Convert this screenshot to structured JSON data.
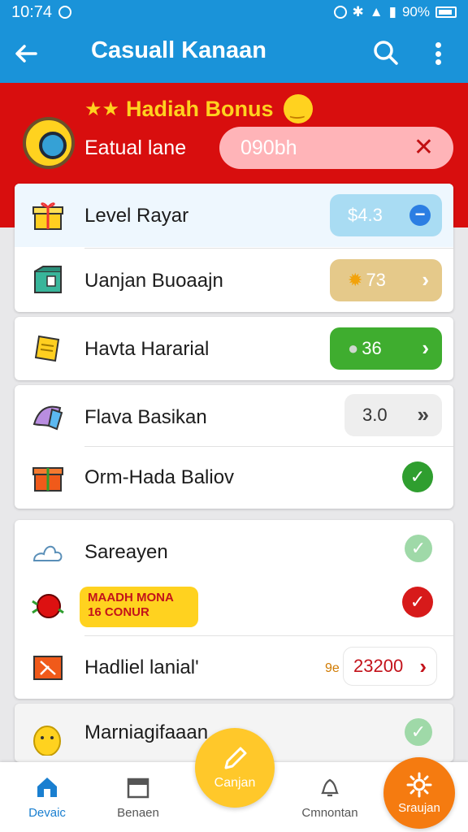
{
  "status": {
    "time": "10:74",
    "battery": "90%"
  },
  "appbar": {
    "title": "Casuall Kanaan"
  },
  "banner": {
    "title": "Hadiah Bonus",
    "subtitle": "Eatual lane",
    "code_value": "090bh"
  },
  "list": {
    "card1": [
      {
        "label": "Level Rayar",
        "value": "$4.3",
        "icon": "gift-box-icon",
        "action": "minus"
      },
      {
        "label": "Uanjan Buoaajn",
        "value": "73",
        "icon": "package-icon",
        "action": "chevron"
      }
    ],
    "card2": [
      {
        "label": "Havta Hararial",
        "value": "36",
        "icon": "ticket-icon",
        "action": "chevron"
      }
    ],
    "card3": [
      {
        "label": "Flava Basikan",
        "value": "3.0",
        "icon": "ribbon-icon",
        "action": "chevron"
      },
      {
        "label": "Orm-Hada Baliov",
        "icon": "present-icon",
        "action": "check"
      }
    ],
    "card4": [
      {
        "label": "Sareayen",
        "icon": "cloud-icon",
        "action": "check-faded"
      },
      {
        "tag": "MAADH MONA 16 CONUR",
        "icon": "apple-icon",
        "action": "check-red"
      },
      {
        "label": "Hadliel lanial'",
        "prefix": "9e",
        "value": "23200",
        "icon": "envelope-icon",
        "action": "chevron-red"
      }
    ],
    "card5": [
      {
        "label": "Marniagifaaan",
        "icon": "chick-icon",
        "action": "check-faded"
      }
    ]
  },
  "bottomnav": {
    "items": [
      {
        "label": "Devaic",
        "icon": "home-icon"
      },
      {
        "label": "Benaen",
        "icon": "calendar-icon"
      },
      {
        "label": "Canjan",
        "icon": "pencil-icon"
      },
      {
        "label": "Cmnontan",
        "icon": "bell-icon"
      },
      {
        "label": "Sraujan",
        "icon": "gear-icon"
      }
    ]
  },
  "colors": {
    "primary": "#1a93d9",
    "banner_red": "#d80e0e",
    "bonus_yellow": "#ffd21f",
    "green": "#2f9e2f",
    "accent_orange": "#f57b10"
  }
}
